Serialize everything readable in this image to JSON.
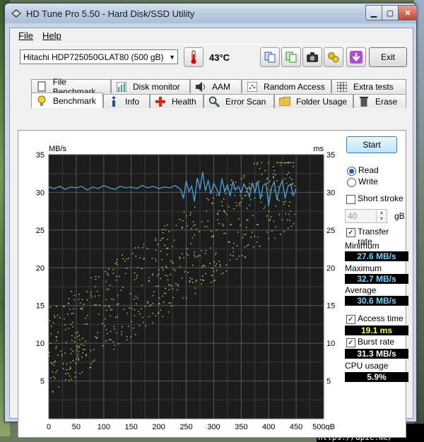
{
  "window": {
    "title": "HD Tune Pro 5.50 - Hard Disk/SSD Utility"
  },
  "menu": {
    "file": "File",
    "help": "Help"
  },
  "toolbar": {
    "drive": "Hitachi HDP725050GLAT80 (500 gB)",
    "temperature": "43°C",
    "exit": "Exit"
  },
  "tabs_top": [
    "File Benchmark",
    "Disk monitor",
    "AAM",
    "Random Access",
    "Extra tests"
  ],
  "tabs_bottom": [
    "Benchmark",
    "Info",
    "Health",
    "Error Scan",
    "Folder Usage",
    "Erase"
  ],
  "side": {
    "start": "Start",
    "read": "Read",
    "write": "Write",
    "short_stroke": "Short stroke",
    "stroke_value": "40",
    "stroke_unit": "gB",
    "transfer_rate": "Transfer rate",
    "minimum_label": "Minimum",
    "minimum_value": "27.6 MB/s",
    "maximum_label": "Maximum",
    "maximum_value": "32.7 MB/s",
    "average_label": "Average",
    "average_value": "30.6 MB/s",
    "access_time_label": "Access time",
    "access_time_value": "19.1 ms",
    "burst_rate_label": "Burst rate",
    "burst_rate_value": "31.3 MB/s",
    "cpu_label": "CPU usage",
    "cpu_value": "5.9%"
  },
  "chart_data": {
    "type": "line",
    "ylabel_left": "MB/s",
    "ylabel_right": "ms",
    "xlim": [
      0,
      500
    ],
    "ylim_left": [
      0,
      35
    ],
    "ylim_right": [
      0,
      35
    ],
    "xticks": [
      "0",
      "50",
      "100",
      "150",
      "200",
      "250",
      "300",
      "350",
      "400",
      "450",
      "500gB"
    ],
    "yticks_left": [
      "35",
      "30",
      "25",
      "20",
      "15",
      "10",
      "5"
    ],
    "yticks_right": [
      "35",
      "30",
      "25",
      "20",
      "15",
      "10",
      "5"
    ],
    "grid": true,
    "series": [
      {
        "name": "Transfer rate",
        "color": "#4aa3e0",
        "x": [
          0,
          10,
          20,
          30,
          40,
          50,
          60,
          70,
          80,
          90,
          100,
          110,
          120,
          130,
          140,
          150,
          160,
          170,
          180,
          190,
          200,
          210,
          220,
          230,
          240,
          245,
          250,
          255,
          260,
          265,
          270,
          275,
          280,
          285,
          290,
          295,
          300,
          305,
          310,
          315,
          320,
          325,
          330,
          335,
          340,
          345,
          350,
          355,
          360,
          365,
          370,
          375,
          380,
          385,
          390,
          395,
          400,
          405,
          410,
          415,
          420,
          425,
          430,
          435,
          440,
          445,
          450
        ],
        "y": [
          30.7,
          30.5,
          30.8,
          30.4,
          30.7,
          30.6,
          30.8,
          30.3,
          30.7,
          30.5,
          30.9,
          30.6,
          30.4,
          30.8,
          30.6,
          30.7,
          30.5,
          30.9,
          30.6,
          30.8,
          30.5,
          30.7,
          30.6,
          30.9,
          30.4,
          29.2,
          31.5,
          30.1,
          30.8,
          28.8,
          31.9,
          30.4,
          32.7,
          30.2,
          31.6,
          29.8,
          31.2,
          30.5,
          29.6,
          31.8,
          30.1,
          31.0,
          29.5,
          31.4,
          30.3,
          30.8,
          29.9,
          31.1,
          30.4,
          29.4,
          31.3,
          30.0,
          31.5,
          29.1,
          30.9,
          31.2,
          28.3,
          30.6,
          31.4,
          29.0,
          30.7,
          31.6,
          29.2,
          30.8,
          31.1,
          29.6,
          30.5
        ]
      },
      {
        "name": "Access time",
        "color": "#d8e060",
        "type": "scatter",
        "range_start": [
          0,
          3
        ],
        "range_end": [
          450,
          34
        ]
      }
    ]
  },
  "footer": "[650x650] https://upic.me/"
}
